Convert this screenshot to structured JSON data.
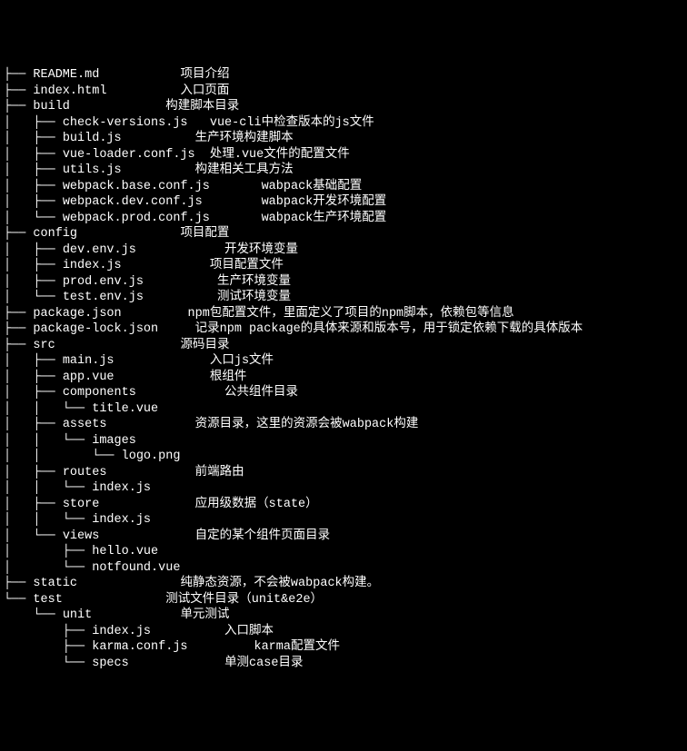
{
  "tree": [
    {
      "prefix": "├── ",
      "name": "README.md",
      "desc_col": 24,
      "desc": "项目介绍"
    },
    {
      "prefix": "├── ",
      "name": "index.html",
      "desc_col": 24,
      "desc": "入口页面"
    },
    {
      "prefix": "├── ",
      "name": "build",
      "desc_col": 22,
      "desc": "构建脚本目录"
    },
    {
      "prefix": "│   ├── ",
      "name": "check-versions.js",
      "desc_col": 28,
      "desc": "vue-cli中检查版本的js文件"
    },
    {
      "prefix": "│   ├── ",
      "name": "build.js",
      "desc_col": 26,
      "desc": "生产环境构建脚本"
    },
    {
      "prefix": "│   ├── ",
      "name": "vue-loader.conf.js",
      "desc_col": 28,
      "desc": "处理.vue文件的配置文件"
    },
    {
      "prefix": "│   ├── ",
      "name": "utils.js",
      "desc_col": 26,
      "desc": "构建相关工具方法"
    },
    {
      "prefix": "│   ├── ",
      "name": "webpack.base.conf.js",
      "desc_col": 35,
      "desc": "wabpack基础配置"
    },
    {
      "prefix": "│   ├── ",
      "name": "webpack.dev.conf.js",
      "desc_col": 35,
      "desc": "wabpack开发环境配置"
    },
    {
      "prefix": "│   └── ",
      "name": "webpack.prod.conf.js",
      "desc_col": 35,
      "desc": "wabpack生产环境配置"
    },
    {
      "prefix": "├── ",
      "name": "config",
      "desc_col": 24,
      "desc": "项目配置"
    },
    {
      "prefix": "│   ├── ",
      "name": "dev.env.js",
      "desc_col": 30,
      "desc": "开发环境变量"
    },
    {
      "prefix": "│   ├── ",
      "name": "index.js",
      "desc_col": 28,
      "desc": "项目配置文件"
    },
    {
      "prefix": "│   ├── ",
      "name": "prod.env.js",
      "desc_col": 29,
      "desc": "生产环境变量"
    },
    {
      "prefix": "│   └── ",
      "name": "test.env.js",
      "desc_col": 29,
      "desc": "测试环境变量"
    },
    {
      "prefix": "├── ",
      "name": "package.json",
      "desc_col": 25,
      "desc": "npm包配置文件，里面定义了项目的npm脚本，依赖包等信息"
    },
    {
      "prefix": "├── ",
      "name": "package-lock.json",
      "desc_col": 26,
      "desc": "记录npm package的具体来源和版本号，用于锁定依赖下载的具体版本"
    },
    {
      "prefix": "├── ",
      "name": "src",
      "desc_col": 24,
      "desc": "源码目录"
    },
    {
      "prefix": "│   ├── ",
      "name": "main.js",
      "desc_col": 28,
      "desc": "入口js文件"
    },
    {
      "prefix": "│   ├── ",
      "name": "app.vue",
      "desc_col": 28,
      "desc": "根组件"
    },
    {
      "prefix": "│   ├── ",
      "name": "components",
      "desc_col": 30,
      "desc": "公共组件目录"
    },
    {
      "prefix": "│   │   └── ",
      "name": "title.vue",
      "desc_col": 0,
      "desc": ""
    },
    {
      "prefix": "│   ├── ",
      "name": "assets",
      "desc_col": 26,
      "desc": "资源目录，这里的资源会被wabpack构建"
    },
    {
      "prefix": "│   │   └── ",
      "name": "images",
      "desc_col": 0,
      "desc": ""
    },
    {
      "prefix": "│   │       └── ",
      "name": "logo.png",
      "desc_col": 0,
      "desc": ""
    },
    {
      "prefix": "│   ├── ",
      "name": "routes",
      "desc_col": 26,
      "desc": "前端路由"
    },
    {
      "prefix": "│   │   └── ",
      "name": "index.js",
      "desc_col": 0,
      "desc": ""
    },
    {
      "prefix": "│   ├── ",
      "name": "store",
      "desc_col": 26,
      "desc": "应用级数据（state）"
    },
    {
      "prefix": "│   │   └── ",
      "name": "index.js",
      "desc_col": 0,
      "desc": ""
    },
    {
      "prefix": "│   └── ",
      "name": "views",
      "desc_col": 26,
      "desc": "自定的某个组件页面目录"
    },
    {
      "prefix": "│       ├── ",
      "name": "hello.vue",
      "desc_col": 0,
      "desc": ""
    },
    {
      "prefix": "│       └── ",
      "name": "notfound.vue",
      "desc_col": 0,
      "desc": ""
    },
    {
      "prefix": "├── ",
      "name": "static",
      "desc_col": 24,
      "desc": "纯静态资源，不会被wabpack构建。"
    },
    {
      "prefix": "└── ",
      "name": "test",
      "desc_col": 22,
      "desc": "测试文件目录（unit&e2e）"
    },
    {
      "prefix": "    └── ",
      "name": "unit",
      "desc_col": 24,
      "desc": "单元测试"
    },
    {
      "prefix": "        ├── ",
      "name": "index.js",
      "desc_col": 30,
      "desc": "入口脚本"
    },
    {
      "prefix": "        ├── ",
      "name": "karma.conf.js",
      "desc_col": 34,
      "desc": "karma配置文件"
    },
    {
      "prefix": "        └── ",
      "name": "specs",
      "desc_col": 30,
      "desc": "单测case目录"
    }
  ]
}
